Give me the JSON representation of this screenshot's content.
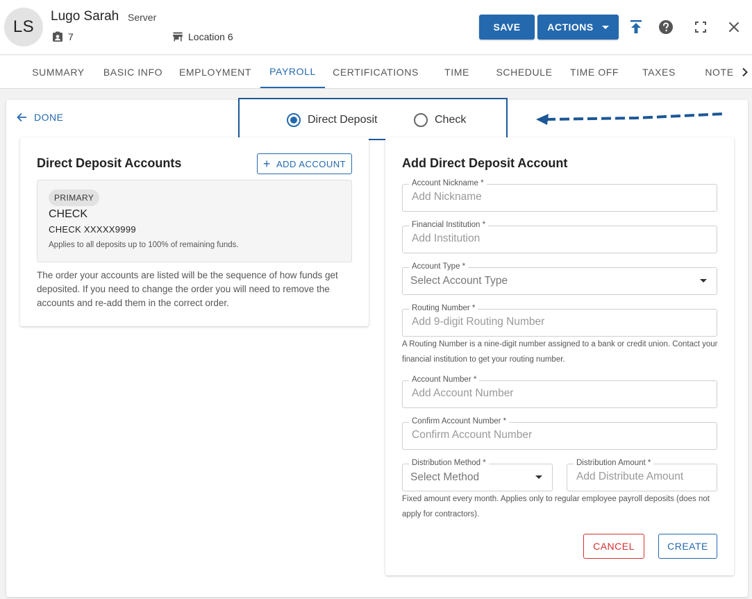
{
  "employee": {
    "initials": "LS",
    "name": "Lugo Sarah",
    "role": "Server",
    "id_value": "7",
    "location": "Location 6"
  },
  "header_actions": {
    "save_label": "SAVE",
    "actions_label": "ACTIONS",
    "icons": [
      "upload-icon",
      "help-icon",
      "fullscreen-icon",
      "close-icon"
    ]
  },
  "tabs": [
    {
      "label": "SUMMARY",
      "active": false
    },
    {
      "label": "BASIC INFO",
      "active": false
    },
    {
      "label": "EMPLOYMENT",
      "active": false
    },
    {
      "label": "PAYROLL",
      "active": true
    },
    {
      "label": "CERTIFICATIONS",
      "active": false
    },
    {
      "label": "TIME",
      "active": false
    },
    {
      "label": "SCHEDULE",
      "active": false
    },
    {
      "label": "TIME OFF",
      "active": false
    },
    {
      "label": "TAXES",
      "active": false
    },
    {
      "label": "NOTE",
      "active": false
    }
  ],
  "done_label": "DONE",
  "payment_method": {
    "options": [
      "Direct Deposit",
      "Check"
    ],
    "selected": "Direct Deposit"
  },
  "accounts_panel": {
    "title": "Direct Deposit Accounts",
    "add_label": "ADD ACCOUNT",
    "account": {
      "badge": "PRIMARY",
      "type": "CHECK",
      "number": "CHECK XXXXX9999",
      "note": "Applies to all deposits up to 100% of remaining funds."
    },
    "order_note": "The order your accounts are listed will be the sequence of how funds get deposited. If you need to change the order you will need to remove the accounts and re-add them in the correct order."
  },
  "form": {
    "title": "Add Direct Deposit Account",
    "nickname": {
      "label": "Account Nickname *",
      "placeholder": "Add Nickname"
    },
    "institution": {
      "label": "Financial Institution *",
      "placeholder": "Add Institution"
    },
    "account_type": {
      "label": "Account Type *",
      "value": "Select Account Type"
    },
    "routing": {
      "label": "Routing Number *",
      "placeholder": "Add 9-digit Routing Number"
    },
    "routing_help": "A Routing Number is a nine-digit number assigned to a bank or credit union. Contact your financial institution to get your routing number.",
    "account_number": {
      "label": "Account Number *",
      "placeholder": "Add Account Number"
    },
    "confirm_account": {
      "label": "Confirm Account Number *",
      "placeholder": "Confirm Account Number"
    },
    "distribution_method": {
      "label": "Distribution Method *",
      "value": "Select Method"
    },
    "distribution_amount": {
      "label": "Distribution Amount *",
      "placeholder": "Add Distribute Amount"
    },
    "distribution_help": "Fixed amount every month. Applies only to regular employee payroll deposits (does not apply for contractors).",
    "cancel_label": "CANCEL",
    "create_label": "CREATE"
  },
  "colors": {
    "primary": "#2469ad",
    "danger": "#d32f2f",
    "highlight_border": "#1c5796"
  }
}
